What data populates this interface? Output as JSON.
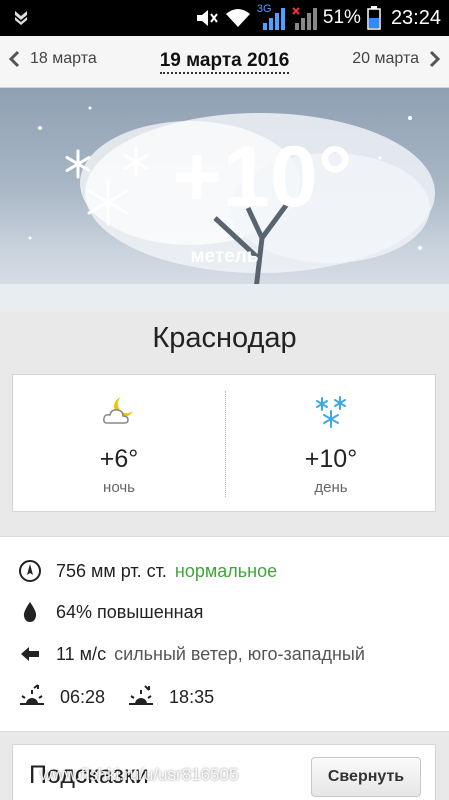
{
  "statusbar": {
    "network_label": "3G",
    "battery": "51%",
    "time": "23:24"
  },
  "datenav": {
    "prev_date": "18 марта",
    "current_date": "19 марта 2016",
    "next_date": "20 марта"
  },
  "hero": {
    "temperature": "+10°",
    "condition": "метель",
    "icon": "snowflakes-icon"
  },
  "city": "Краснодар",
  "forecast": {
    "night": {
      "temperature": "+6°",
      "label": "ночь",
      "icon": "moon-cloud-icon"
    },
    "day": {
      "temperature": "+10°",
      "label": "день",
      "icon": "snowflakes-icon"
    }
  },
  "details": {
    "pressure": {
      "value": "756 мм рт. ст.",
      "status": "нормальное",
      "icon": "compass-icon"
    },
    "humidity": {
      "value": "64% повышенная",
      "icon": "drop-icon"
    },
    "wind": {
      "speed": "11 м/с",
      "description": "сильный ветер, юго-западный",
      "icon": "arrow-left-icon"
    },
    "sunrise": "06:28",
    "sunset": "18:35"
  },
  "hints": {
    "title": "Подсказки",
    "collapse_button": "Свернуть"
  },
  "watermark": "www.fishki.ru/u/usr816505",
  "colors": {
    "accent_green": "#3fa63a",
    "hero_bg": "#a9b7c6",
    "status_bar": "#000000"
  }
}
